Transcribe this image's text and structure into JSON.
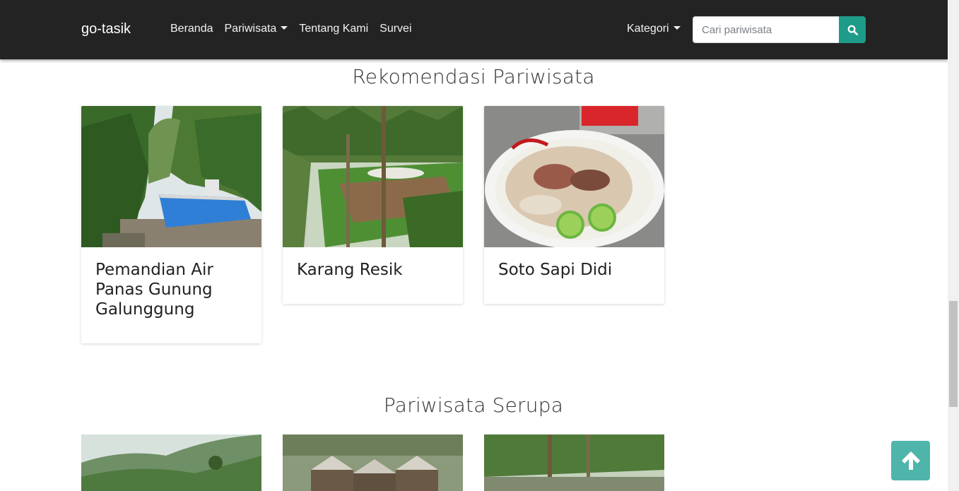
{
  "navbar": {
    "brand": "go-tasik",
    "links": [
      "Beranda",
      "Pariwisata",
      "Tentang Kami",
      "Survei"
    ],
    "kategori": "Kategori",
    "search_placeholder": "Cari pariwisata"
  },
  "recommend": {
    "title": "Rekomendasi Pariwisata",
    "cards": [
      {
        "title": "Pemandian Air Panas Gunung Galunggung"
      },
      {
        "title": "Karang Resik"
      },
      {
        "title": "Soto Sapi Didi"
      }
    ]
  },
  "similar": {
    "title": "Pariwisata Serupa"
  },
  "icons": {
    "search": "search-icon",
    "back_to_top": "arrow-up-icon"
  },
  "colors": {
    "navbar": "#232323",
    "search_button": "#1e9c89",
    "back_to_top": "#4fb5ab"
  }
}
